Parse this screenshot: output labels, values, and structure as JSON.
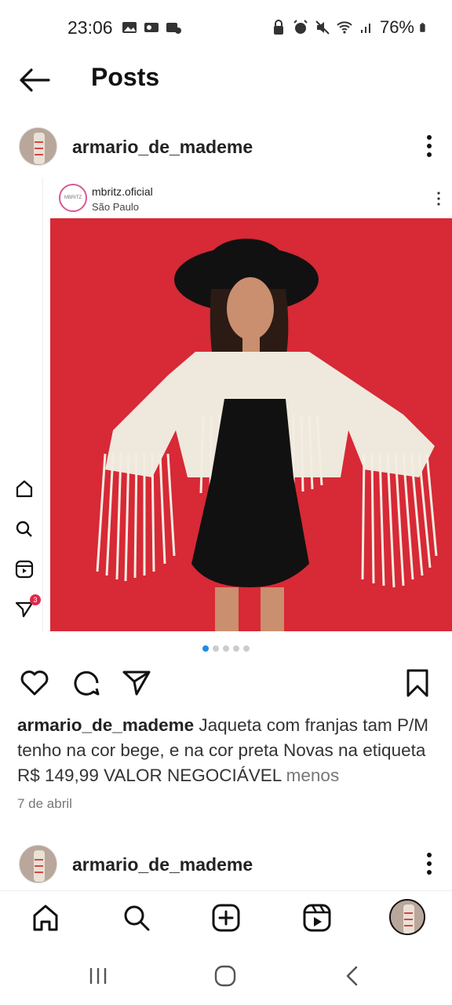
{
  "status": {
    "time": "23:06",
    "battery": "76%"
  },
  "header": {
    "title": "Posts"
  },
  "post": {
    "username": "armario_de_mademe",
    "embed": {
      "username": "mbritz.oficial",
      "location": "São Paulo",
      "avatar_text": "MBRITZ"
    },
    "carousel": {
      "total": 5,
      "current": 1
    },
    "caption_username": "armario_de_mademe",
    "caption_text": " Jaqueta com franjas tam P/M tenho na cor bege, e na cor preta Novas na etiqueta R$ 149,99 VALOR NEGOCIÁVEL ",
    "caption_more": "menos",
    "date": "7 de abril"
  },
  "next_post": {
    "username": "armario_de_mademe"
  },
  "side_nav": {
    "notification_count": "3"
  },
  "colors": {
    "photo_background": "#d72936",
    "active_dot": "#1f8ce6",
    "badge": "#e0284a"
  }
}
